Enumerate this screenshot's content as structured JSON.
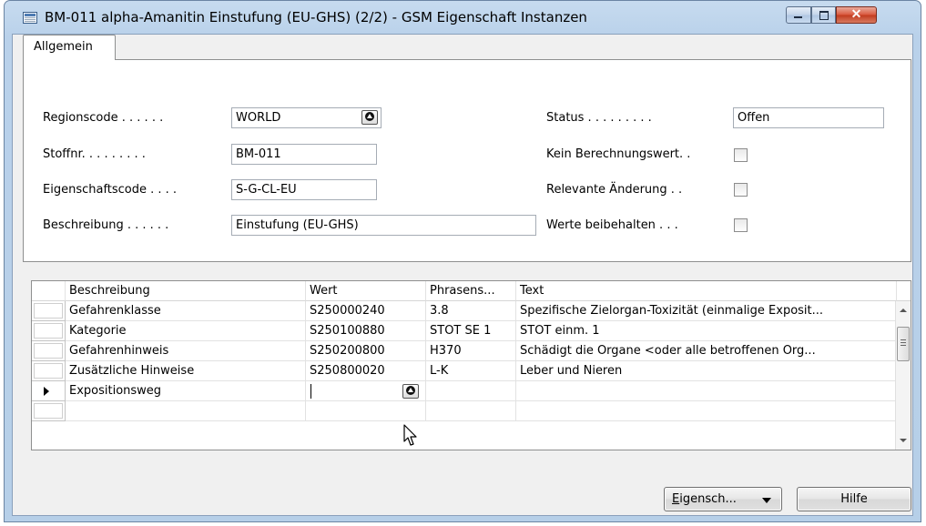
{
  "window": {
    "title": "BM-011 alpha-Amanitin Einstufung (EU-GHS) (2/2) - GSM Eigenschaft Instanzen",
    "close_glyph": "✕"
  },
  "tabs": [
    {
      "label": "Allgemein",
      "active": true
    }
  ],
  "general": {
    "regionscode": {
      "label": "Regionscode . . . . . .",
      "value": "WORLD"
    },
    "stoffnr": {
      "label": "Stoffnr. . . . . . . . .",
      "value": "BM-011"
    },
    "eigenschaftscode": {
      "label": "Eigenschaftscode . . . .",
      "value": "S-G-CL-EU"
    },
    "beschreibung": {
      "label": "Beschreibung . . . . . .",
      "value": "Einstufung (EU-GHS)"
    },
    "status": {
      "label": "Status . . . . . . . . .",
      "value": "Offen"
    },
    "kein_berechnungswert": {
      "label": "Kein Berechnungswert. .",
      "checked": false
    },
    "relevante_aenderung": {
      "label": "Relevante Änderung . .",
      "checked": false
    },
    "werte_beibehalten": {
      "label": "Werte beibehalten . . .",
      "checked": false
    }
  },
  "table": {
    "columns": [
      "Beschreibung",
      "Wert",
      "Phrasens...",
      "Text"
    ],
    "rows": [
      {
        "beschreibung": "Gefahrenklasse",
        "wert": "S250000240",
        "phrase": "3.8",
        "text": "Spezifische Zielorgan-Toxizität (einmalige Exposit..."
      },
      {
        "beschreibung": "Kategorie",
        "wert": "S250100880",
        "phrase": "STOT SE 1",
        "text": "STOT einm. 1"
      },
      {
        "beschreibung": "Gefahrenhinweis",
        "wert": "S250200800",
        "phrase": "H370",
        "text": "Schädigt die Organe <oder alle betroffenen Org..."
      },
      {
        "beschreibung": "Zusätzliche Hinweise",
        "wert": "S250800020",
        "phrase": "L-K",
        "text": "Leber und Nieren"
      },
      {
        "beschreibung": "Expositionsweg",
        "wert": "",
        "phrase": "",
        "text": "",
        "current": true
      },
      {
        "beschreibung": "",
        "wert": "",
        "phrase": "",
        "text": ""
      }
    ]
  },
  "buttons": {
    "eigenschaften": {
      "label_accel": "E",
      "label_rest": "igensch...",
      "icon": "dropdown-arrow-icon"
    },
    "hilfe": {
      "label": "Hilfe"
    }
  },
  "icons": {
    "lookup": "lookup-arrow-icon",
    "pointer": "mouse-pointer-icon"
  },
  "colors": {
    "titlebar": "#b9d1ea",
    "close_button": "#c23a1e",
    "panel": "#ffffff",
    "client": "#f0f0f0"
  }
}
